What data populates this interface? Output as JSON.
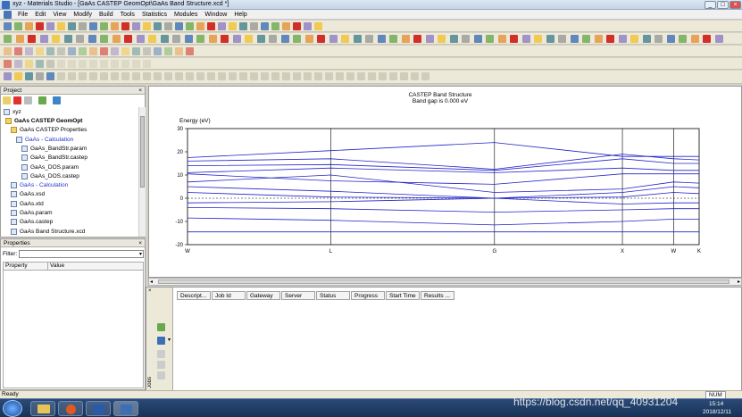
{
  "window": {
    "title": "xyz - Materials Studio - [GaAs CASTEP GeomOpt\\GaAs Band Structure.xcd *]",
    "min": "_",
    "max": "□",
    "close": "×"
  },
  "menu": [
    "File",
    "Edit",
    "View",
    "Modify",
    "Build",
    "Tools",
    "Statistics",
    "Modules",
    "Window",
    "Help"
  ],
  "project": {
    "header": "Project",
    "root": "xyz",
    "items": [
      {
        "label": "GaAs CASTEP GeomOpt",
        "bold": true
      },
      {
        "label": "GaAs CASTEP Properties"
      },
      {
        "label": "GaAs - Calculation",
        "link": true
      },
      {
        "label": "GaAs_BandStr.param"
      },
      {
        "label": "GaAs_BandStr.castep"
      },
      {
        "label": "GaAs_DOS.param"
      },
      {
        "label": "GaAs_DOS.castep"
      },
      {
        "label": "GaAs - Calculation",
        "link": true
      },
      {
        "label": "GaAs.xsd"
      },
      {
        "label": "GaAs.xtd"
      },
      {
        "label": "GaAs.param"
      },
      {
        "label": "GaAs.castep"
      },
      {
        "label": "GaAs Band Structure.xcd"
      }
    ]
  },
  "properties": {
    "header": "Properties",
    "filter_label": "Filter:",
    "col_property": "Property",
    "col_value": "Value"
  },
  "chart_data": {
    "type": "line",
    "title": "CASTEP Band Structure",
    "subtitle": "Band gap is 0.000 eV",
    "ylabel": "Energy (eV)",
    "ylim": [
      -20,
      30
    ],
    "yticks": [
      30,
      20,
      10,
      0,
      -10,
      -20
    ],
    "kpoints": [
      "W",
      "L",
      "G",
      "X",
      "W",
      "K"
    ],
    "kpos": [
      0,
      0.28,
      0.6,
      0.85,
      0.95,
      1.0
    ],
    "fermi": 0,
    "series": [
      {
        "values": [
          -14.5,
          -14.5,
          -14.5,
          -14.5,
          -14.5,
          -14.5
        ]
      },
      {
        "values": [
          -8.5,
          -9.5,
          -11.5,
          -10.0,
          -9.0,
          -9.0
        ]
      },
      {
        "values": [
          -4.0,
          -4.5,
          -6.0,
          -5.0,
          -4.5,
          -4.5
        ]
      },
      {
        "values": [
          -2.0,
          -1.5,
          0.0,
          -2.5,
          -2.0,
          -2.0
        ]
      },
      {
        "values": [
          2.5,
          0.5,
          0.0,
          0.5,
          2.5,
          2.0
        ]
      },
      {
        "values": [
          5.0,
          3.0,
          0.0,
          2.5,
          5.0,
          4.5
        ]
      },
      {
        "values": [
          7.0,
          10.0,
          2.5,
          4.0,
          7.0,
          6.5
        ]
      },
      {
        "values": [
          11.0,
          13.0,
          11.0,
          13.0,
          12.0,
          12.0
        ]
      },
      {
        "values": [
          14.0,
          14.5,
          12.0,
          17.0,
          15.0,
          15.0
        ]
      },
      {
        "values": [
          16.0,
          17.0,
          12.5,
          19.0,
          17.0,
          16.5
        ]
      },
      {
        "values": [
          17.5,
          20.5,
          24.0,
          18.0,
          18.0,
          18.0
        ]
      },
      {
        "values": [
          10.5,
          7.5,
          6.0,
          10.5,
          10.5,
          10.5
        ]
      }
    ]
  },
  "jobs": {
    "side_label": "Jobs",
    "columns": [
      "Descript...",
      "Job Id",
      "Gateway",
      "Server",
      "Status",
      "Progress",
      "Start Time",
      "Results ..."
    ]
  },
  "status": {
    "left": "Ready",
    "num": "NUM"
  },
  "taskbar": {
    "watermark": "https://blog.csdn.net/qq_40931204",
    "time": "15:14",
    "date": "2018/12/11"
  },
  "colors": {
    "band": "#2222cc",
    "axis": "#000000"
  }
}
